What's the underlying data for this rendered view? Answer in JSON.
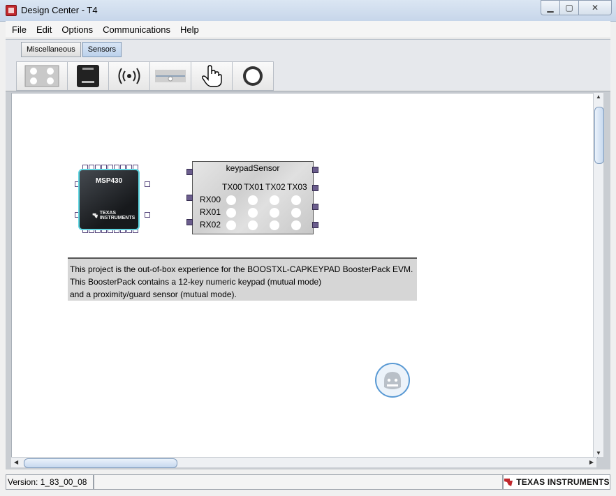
{
  "window": {
    "title": "Design Center - T4"
  },
  "menu": [
    "File",
    "Edit",
    "Options",
    "Communications",
    "Help"
  ],
  "palette": {
    "tabs": [
      {
        "label": "Miscellaneous",
        "active": false
      },
      {
        "label": "Sensors",
        "active": true
      }
    ],
    "tools": [
      "keypad-tool-icon",
      "msp430-tool-icon",
      "proximity-tool-icon",
      "slider-tool-icon",
      "button-tool-icon",
      "wheel-tool-icon"
    ]
  },
  "canvas": {
    "msp430": {
      "label": "MSP430",
      "logo": "TEXAS INSTRUMENTS"
    },
    "keypad": {
      "title": "keypadSensor",
      "tx": [
        "TX00",
        "TX01",
        "TX02",
        "TX03"
      ],
      "rx": [
        "RX00",
        "RX01",
        "RX02"
      ]
    },
    "description": [
      "This project is the out-of-box experience for the BOOSTXL-CAPKEYPAD BoosterPack EVM.",
      "This BoosterPack contains a 12-key numeric keypad (mutual mode)",
      "and a proximity/guard sensor (mutual mode)."
    ]
  },
  "status": {
    "version": "Version: 1_83_00_08",
    "brand": "TEXAS INSTRUMENTS"
  },
  "colors": {
    "ti_red": "#c0282d",
    "chip_border": "#5fd6e2"
  }
}
